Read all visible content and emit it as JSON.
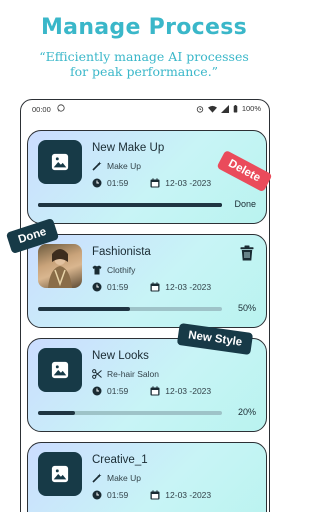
{
  "header": {
    "title": "Manage Process",
    "tagline": "“Efficiently manage AI processes for peak performance.”"
  },
  "status_bar": {
    "time": "00:00",
    "battery": "100%"
  },
  "cards": [
    {
      "title": "New Make Up",
      "tool_icon": "magic-wand-icon",
      "tool": "Make Up",
      "duration": "01:59",
      "date": "12-03 -2023",
      "progress_label": "Done",
      "progress": 1.0
    },
    {
      "title": "Fashionista",
      "tool_icon": "shirt-icon",
      "tool": "Clothify",
      "duration": "01:59",
      "date": "12-03 -2023",
      "progress_label": "50%",
      "progress": 0.5
    },
    {
      "title": "New Looks",
      "tool_icon": "scissors-icon",
      "tool": "Re-hair Salon",
      "duration": "01:59",
      "date": "12-03 -2023",
      "progress_label": "20%",
      "progress": 0.2
    },
    {
      "title": "Creative_1",
      "tool_icon": "magic-wand-icon",
      "tool": "Make Up",
      "duration": "01:59",
      "date": "12-03 -2023"
    }
  ],
  "ribbons": {
    "delete": "Delete",
    "done": "Done",
    "new_style": "New Style"
  },
  "colors": {
    "accent": "#3ab7c9",
    "dark": "#173a47",
    "delete": "#ea4b5b"
  }
}
